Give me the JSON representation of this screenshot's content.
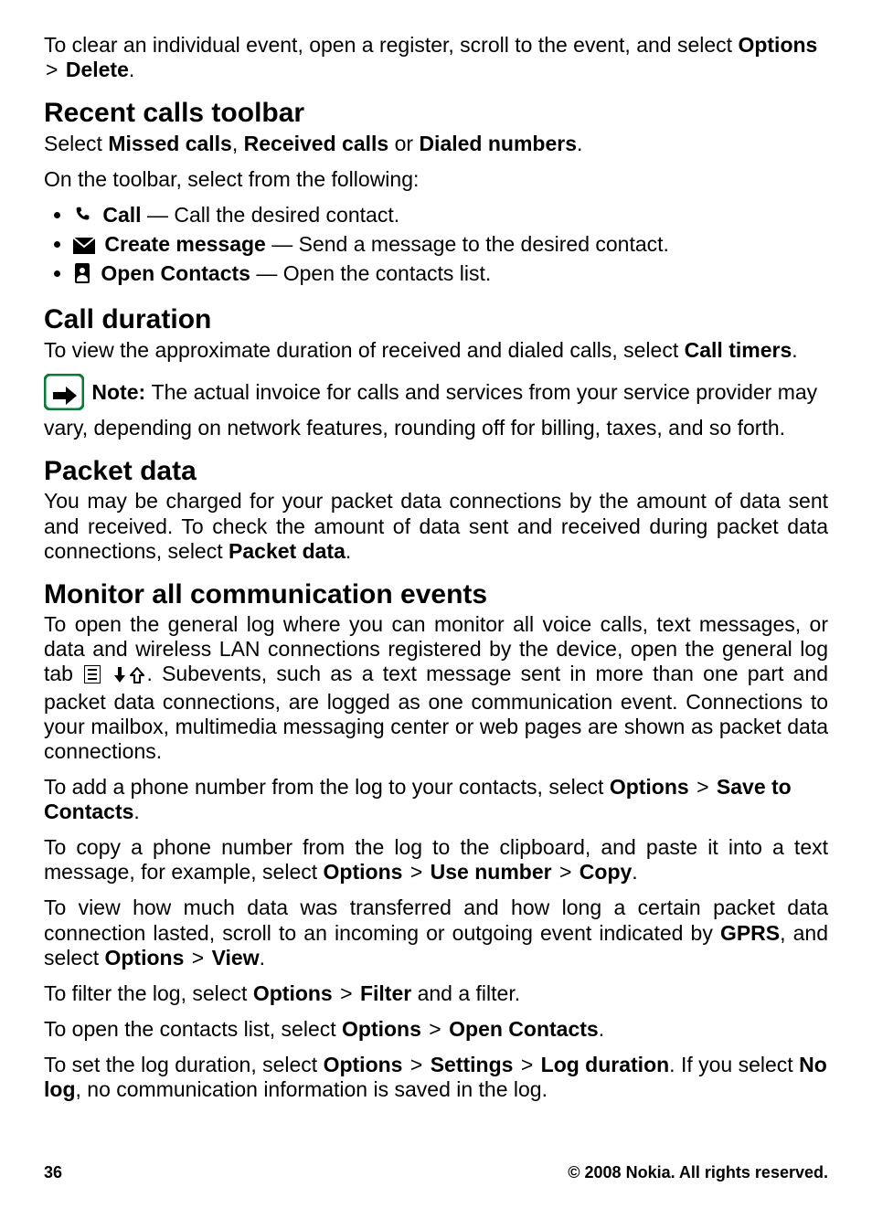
{
  "intro": {
    "p1_a": "To clear an individual event, open a register, scroll to the event, and select ",
    "options": "Options",
    "gt": ">",
    "delete": "Delete",
    "period": "."
  },
  "recent": {
    "heading": "Recent calls toolbar",
    "p1_a": "Select ",
    "missed": "Missed calls",
    "comma": ", ",
    "received": "Received calls",
    "or": " or ",
    "dialed": "Dialed numbers",
    "period": ".",
    "p2": "On the toolbar, select from the following:",
    "items": [
      {
        "label": "Call",
        "desc": "  — Call the desired contact."
      },
      {
        "label": "Create message",
        "desc": "  — Send a message to the desired contact."
      },
      {
        "label": "Open Contacts",
        "desc": "  — Open the contacts list."
      }
    ]
  },
  "duration": {
    "heading": "Call duration",
    "p1_a": "To view the approximate duration of received and dialed calls, select ",
    "timers": "Call timers",
    "period": ".",
    "note_label": "Note: ",
    "note_body": " The actual invoice for calls and services from your service provider may vary, depending on network features, rounding off for billing, taxes, and so forth."
  },
  "packet": {
    "heading": "Packet data",
    "p1_a": "You may be charged for your packet data connections by the amount of data sent and received. To check the amount of data sent and received during packet data connections, select ",
    "pd": "Packet data",
    "period": "."
  },
  "monitor": {
    "heading": "Monitor all communication events",
    "p1_a": "To open the general log where you can monitor all voice calls, text messages, or data and wireless LAN connections registered by the device, open the general log tab ",
    "p1_b": ". Subevents, such as a text message sent in more than one part and packet data connections, are logged as one communication event. Connections to your mailbox, multimedia messaging center or web pages are shown as packet data connections.",
    "p2_a": "To add a phone number from the log to your contacts, select ",
    "options": "Options",
    "gt": ">",
    "save": "Save to Contacts",
    "period": ".",
    "p3_a": "To copy a phone number from the log to the clipboard, and paste it into a text message, for example, select ",
    "use": "Use number",
    "copy": "Copy",
    "p4_a": "To view how much data was transferred and how long a certain packet data connection lasted, scroll to an incoming or outgoing event indicated by ",
    "gprs": "GPRS",
    "p4_b": ", and select ",
    "view": "View",
    "p5_a": "To filter the log, select ",
    "filter": "Filter",
    "p5_b": " and a filter.",
    "p6_a": "To open the contacts list, select ",
    "open": "Open Contacts",
    "p7_a": "To set the log duration, select ",
    "settings": "Settings",
    "logdur": "Log duration",
    "p7_b": ". If you select ",
    "nolog": "No log",
    "p7_c": ", no communication information is saved in the log."
  },
  "footer": {
    "page": "36",
    "copyright": "© 2008 Nokia. All rights reserved."
  }
}
